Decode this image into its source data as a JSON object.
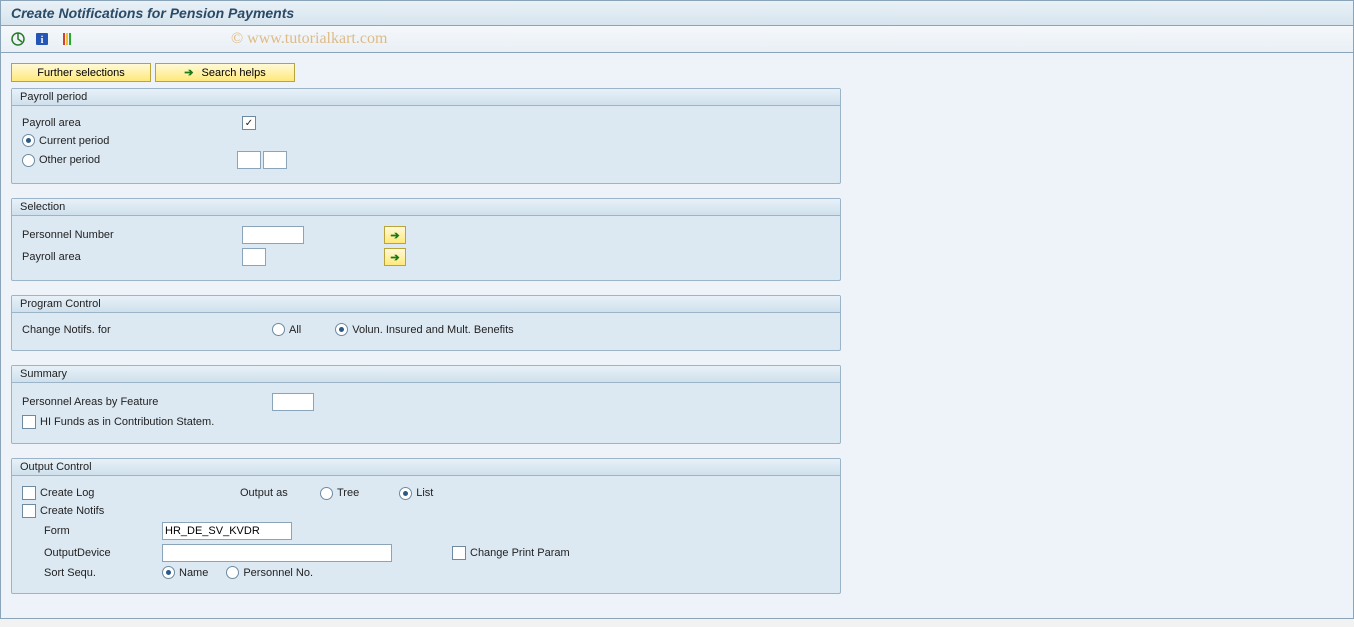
{
  "title": "Create Notifications for Pension Payments",
  "watermark": "© www.tutorialkart.com",
  "toolbar": {
    "execute": "execute",
    "info": "info",
    "variant": "variant"
  },
  "buttons": {
    "further_selections": "Further selections",
    "search_helps": "Search helps"
  },
  "groups": {
    "payroll_period": {
      "title": "Payroll period",
      "payroll_area_label": "Payroll area",
      "current_period_label": "Current period",
      "other_period_label": "Other period",
      "payroll_area_value": "",
      "payroll_area_checked": "✓"
    },
    "selection": {
      "title": "Selection",
      "personnel_number_label": "Personnel Number",
      "payroll_area_label": "Payroll area",
      "personnel_number_value": "",
      "payroll_area_value": ""
    },
    "program_control": {
      "title": "Program Control",
      "change_notifs_label": "Change Notifs. for",
      "opt_all": "All",
      "opt_volun": "Volun. Insured and Mult. Benefits"
    },
    "summary": {
      "title": "Summary",
      "personnel_areas_label": "Personnel Areas by Feature",
      "personnel_areas_value": "",
      "hi_funds_label": "HI Funds as in Contribution Statem."
    },
    "output_control": {
      "title": "Output Control",
      "create_log_label": "Create Log",
      "output_as_label": "Output as",
      "opt_tree": "Tree",
      "opt_list": "List",
      "create_notifs_label": "Create Notifs",
      "form_label": "Form",
      "form_value": "HR_DE_SV_KVDR",
      "output_device_label": "OutputDevice",
      "output_device_value": "",
      "change_print_param_label": "Change Print Param",
      "sort_sequ_label": "Sort Sequ.",
      "opt_name": "Name",
      "opt_personnel_no": "Personnel No."
    }
  }
}
